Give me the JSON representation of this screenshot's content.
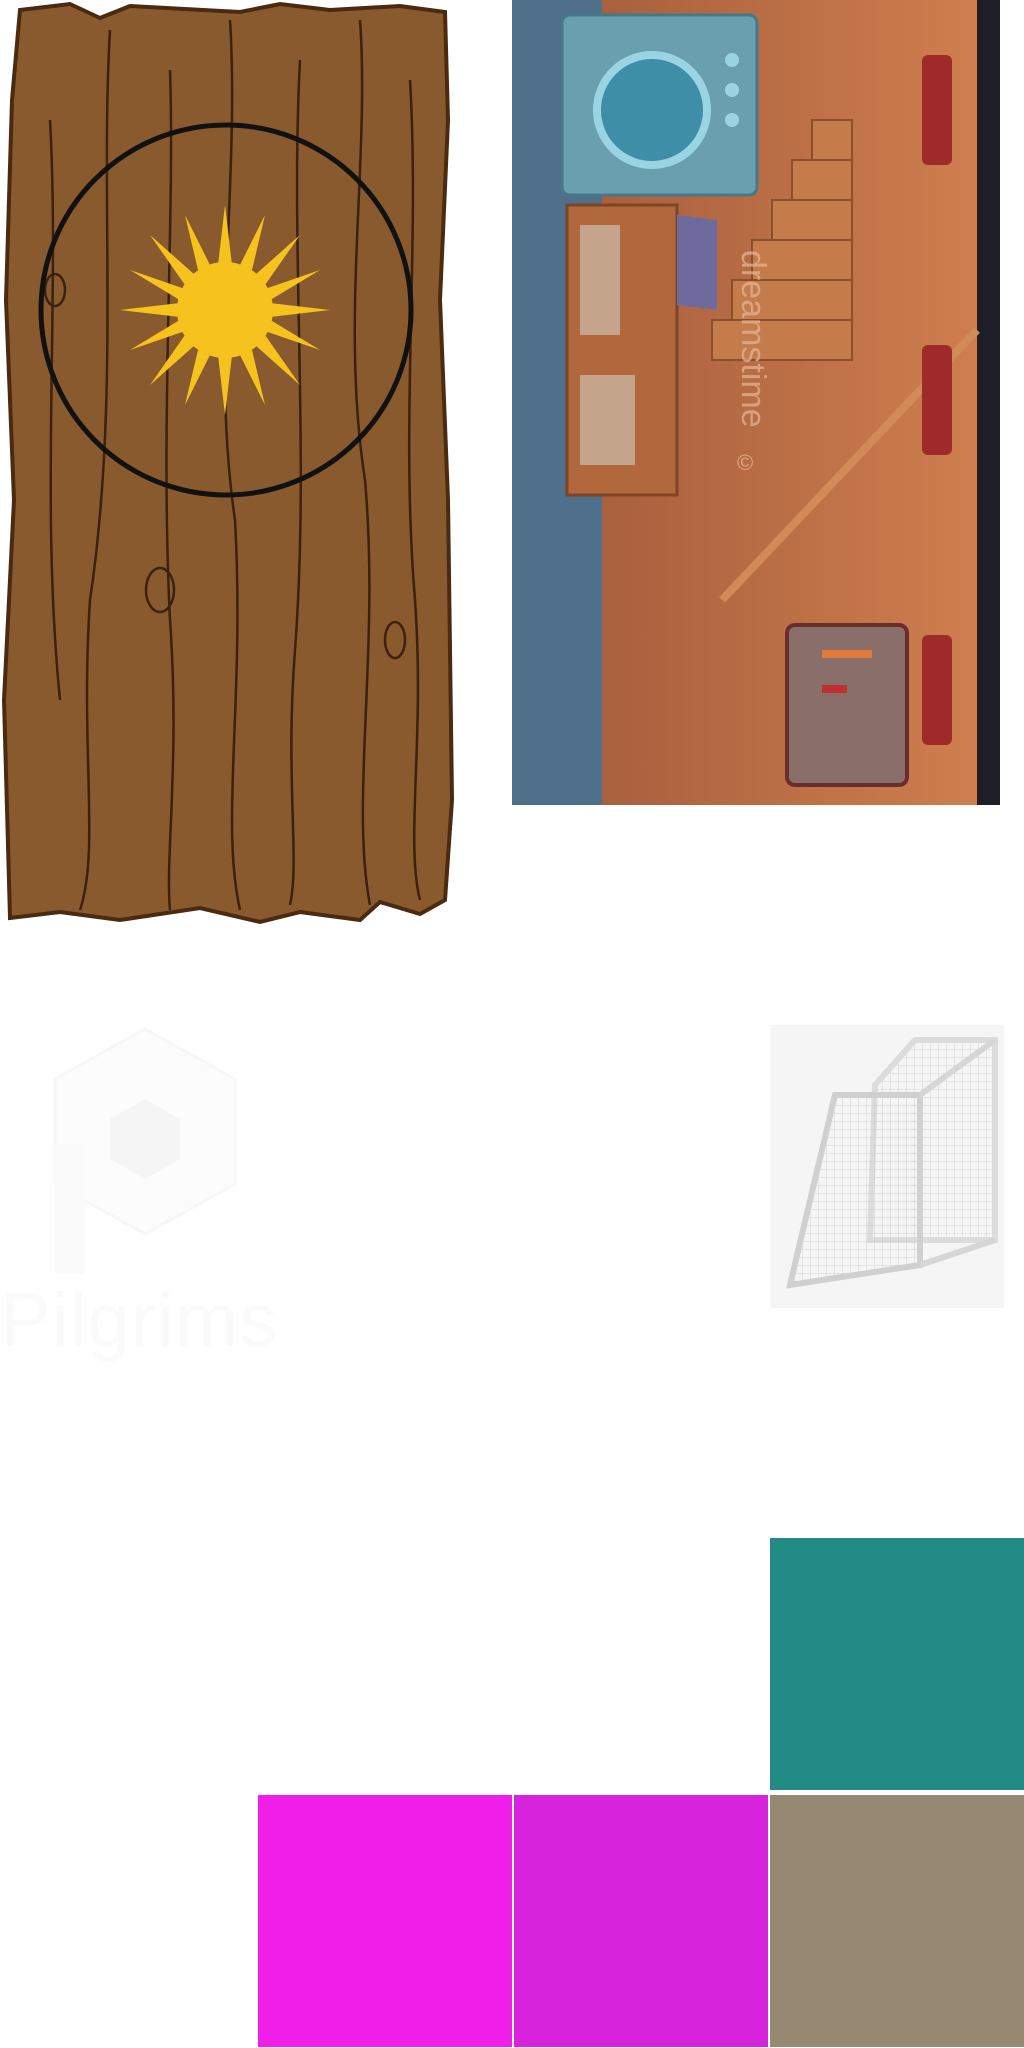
{
  "tiles": {
    "wood_plank": {
      "icon": "sun-icon",
      "circle_color": "#111111",
      "sun_color": "#f6c31e",
      "wood_color": "#8a5a2f"
    },
    "basement": {
      "watermark_lines": [
        "dreamstime",
        "©"
      ],
      "colors": {
        "wall": "#c06e3f",
        "floor": "#4f6f8a"
      }
    },
    "logo": {
      "text": "Pilgrims"
    },
    "goal": {
      "icon": "soccer-goal-icon"
    }
  },
  "swatches": [
    {
      "name": "teal",
      "color": "#238a86"
    },
    {
      "name": "magenta",
      "color": "#f01ee8"
    },
    {
      "name": "purple",
      "color": "#d823dd"
    },
    {
      "name": "khaki",
      "color": "#978871"
    }
  ]
}
